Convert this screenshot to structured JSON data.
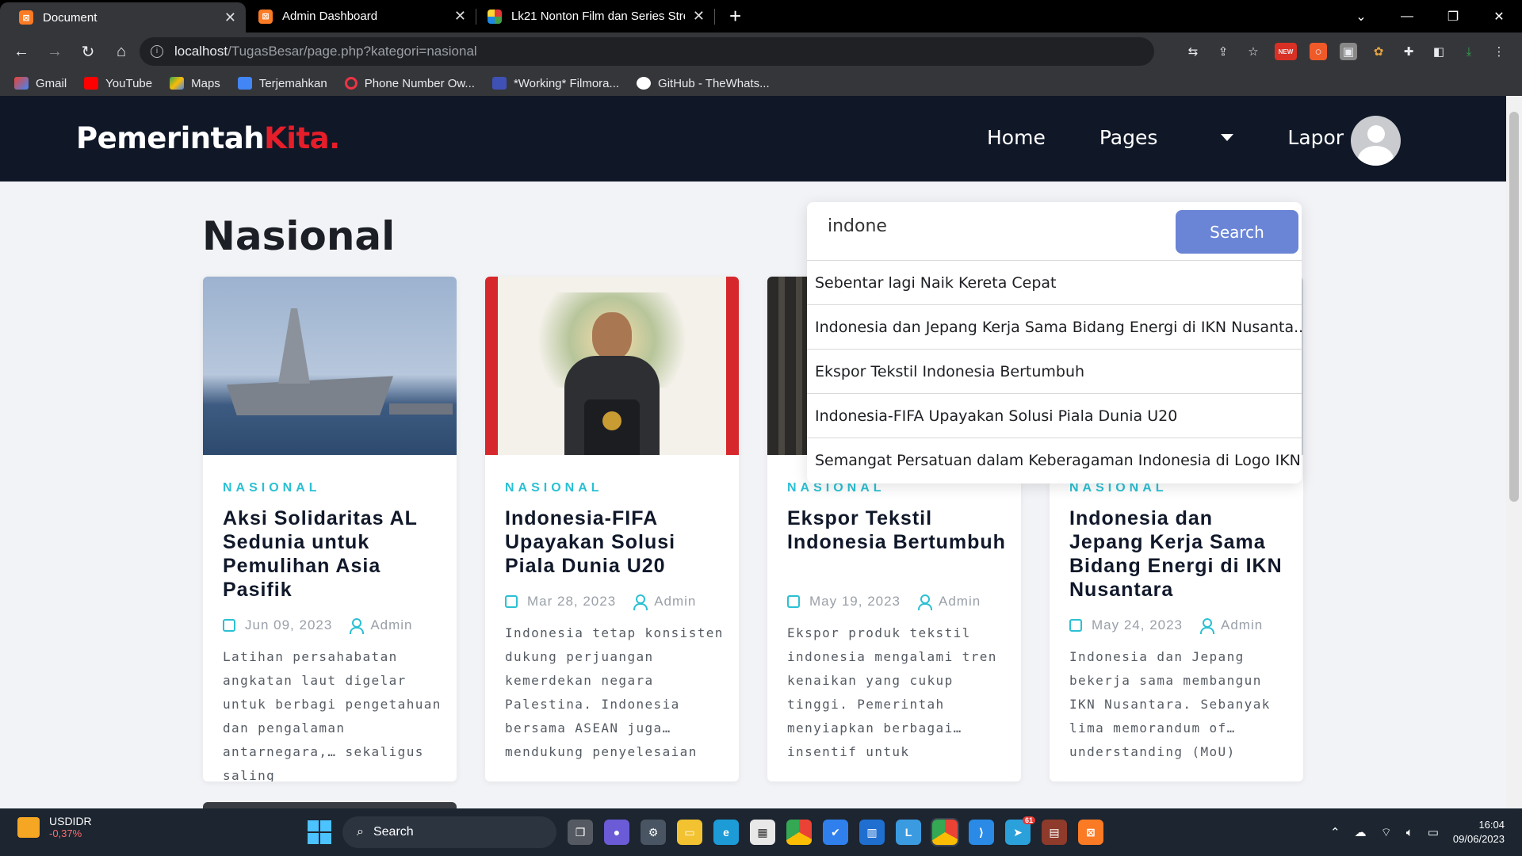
{
  "browser": {
    "tabs": [
      {
        "title": "Document",
        "icon": "xampp-icon",
        "active": true
      },
      {
        "title": "Admin Dashboard",
        "icon": "xampp-icon",
        "active": false
      },
      {
        "title": "Lk21 Nonton Film dan Series Stre",
        "icon": "lk21-icon",
        "active": false
      }
    ],
    "url_host": "localhost",
    "url_path": "/TugasBesar/page.php?kategori=nasional",
    "bookmarks": [
      "Gmail",
      "YouTube",
      "Maps",
      "Terjemahkan",
      "Phone Number Ow...",
      "*Working* Filmora...",
      "GitHub - TheWhats..."
    ],
    "ext_new_badge": "NEW"
  },
  "site": {
    "brand_main": "Pemerintah",
    "brand_accent": "Kita.",
    "nav": {
      "home": "Home",
      "pages": "Pages",
      "lapor": "Lapor"
    },
    "page_title": "Nasional"
  },
  "search": {
    "value": "indone",
    "button": "Search",
    "suggestions": [
      "Sebentar lagi Naik Kereta Cepat",
      "Indonesia dan Jepang Kerja Sama Bidang Energi di IKN Nusanta...",
      "Ekspor Tekstil Indonesia Bertumbuh",
      "Indonesia-FIFA Upayakan Solusi Piala Dunia U20",
      "Semangat Persatuan dalam Keberagaman Indonesia di Logo IKN"
    ]
  },
  "cards": [
    {
      "category": "NASIONAL",
      "title": "Aksi Solidaritas AL Sedunia untuk Pemulihan Asia Pasifik",
      "date": "Jun 09, 2023",
      "author": "Admin",
      "excerpt": "Latihan persahabatan angkatan laut digelar untuk berbagi pengetahuan dan pengalaman antarnegara,… sekaligus saling"
    },
    {
      "category": "NASIONAL",
      "title": "Indonesia-FIFA Upayakan Solusi Piala Dunia U20",
      "date": "Mar 28, 2023",
      "author": "Admin",
      "excerpt": "Indonesia tetap konsisten dukung perjuangan kemerdekan negara Palestina. Indonesia bersama ASEAN juga… mendukung penyelesaian"
    },
    {
      "category": "NASIONAL",
      "title": "Ekspor Tekstil Indonesia Bertumbuh",
      "date": "May 19, 2023",
      "author": "Admin",
      "excerpt": "Ekspor produk tekstil indonesia mengalami tren kenaikan yang cukup tinggi. Pemerintah menyiapkan berbagai… insentif untuk"
    },
    {
      "category": "NASIONAL",
      "title": "Indonesia dan Jepang Kerja Sama Bidang Energi di IKN Nusantara",
      "date": "May 24, 2023",
      "author": "Admin",
      "excerpt": "Indonesia dan Jepang bekerja sama membangun IKN Nusantara. Sebanyak lima memorandum of… understanding (MoU)"
    }
  ],
  "taskbar": {
    "stock_symbol": "USDIDR",
    "stock_change": "-0,37%",
    "search": "Search",
    "time": "16:04",
    "date": "09/06/2023",
    "telegram_badge": "61"
  },
  "colors": {
    "accent": "#e61e2a",
    "category": "#2bc0d3",
    "navbar": "#101828",
    "search_button": "#6b85d6"
  }
}
